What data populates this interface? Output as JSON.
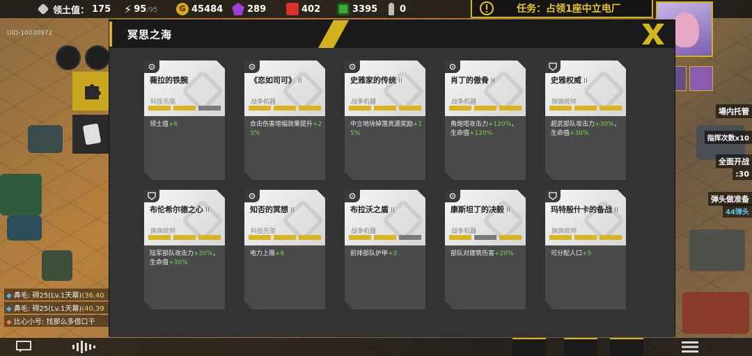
{
  "topbar": {
    "territory_label": "领土值：",
    "territory_value": "175",
    "energy_value": "95",
    "energy_max": "/95",
    "gold_value": "45484",
    "crystal_value": "289",
    "fuel_value": "402",
    "chip_value": "3395",
    "bullet_value": "0"
  },
  "task": {
    "text": "任务：占领1座中立电厂"
  },
  "uid": "UID-10030972",
  "right_panel": {
    "line1": "場内托管",
    "line2": "指挥次数x10",
    "line3": "全面开战",
    "line4": ":30",
    "line5": "弹头做准备",
    "line6": "44弹头"
  },
  "chat": [
    {
      "prefix": "鼻毛: ",
      "text": "碍25(Lv.1天幕)",
      "coord": "(36,40"
    },
    {
      "prefix": "鼻毛: ",
      "text": "碍25(Lv.1天幕)",
      "coord": "(40,39"
    },
    {
      "prefix": "比心小号: ",
      "text": "找那么多借口干",
      "coord": ""
    }
  ],
  "modal": {
    "title": "冥思之海",
    "cards": [
      {
        "name": "薇拉的铁腕",
        "rank": "",
        "category": "科技先驱",
        "bars": [
          1,
          1,
          0
        ],
        "desc": [
          [
            "领土值",
            ""
          ],
          [
            "+6",
            "num"
          ]
        ]
      },
      {
        "name": "《恋如司可》",
        "rank": "II",
        "category": "战争机器",
        "bars": [
          1,
          1,
          1
        ],
        "desc": [
          [
            "合击伤害增幅效果提升",
            ""
          ],
          [
            "+23%",
            "num"
          ]
        ]
      },
      {
        "name": "史雅家的传统",
        "rank": "II",
        "category": "战争机器",
        "bars": [
          1,
          1,
          1
        ],
        "desc": [
          [
            "中立地块掉落资源奖励",
            ""
          ],
          [
            "+15%",
            "num"
          ]
        ]
      },
      {
        "name": "肖丁的傲骨",
        "rank": "II",
        "category": "战争机器",
        "bars": [
          1,
          1,
          1
        ],
        "desc": [
          [
            "角炮塔攻击力",
            ""
          ],
          [
            "+120%",
            "num"
          ],
          [
            "，生命值",
            ""
          ],
          [
            "+120%",
            "num"
          ]
        ]
      },
      {
        "name": "史雅权威",
        "rank": "II",
        "category": "旗旗统帅",
        "bars": [
          1,
          1,
          1
        ],
        "desc": [
          [
            "超武部队攻击力",
            ""
          ],
          [
            "+30%",
            "num"
          ],
          [
            "，生命值",
            ""
          ],
          [
            "+30%",
            "num"
          ]
        ]
      },
      {
        "name": "布伦希尔德之心",
        "rank": "II",
        "category": "旗旗统帅",
        "bars": [
          1,
          1,
          1
        ],
        "desc": [
          [
            "陆军部队攻击力",
            ""
          ],
          [
            "+30%",
            "num"
          ],
          [
            "，生命值",
            ""
          ],
          [
            "+30%",
            "num"
          ]
        ]
      },
      {
        "name": "知否的冥想",
        "rank": "II",
        "category": "科技先驱",
        "bars": [
          1,
          1,
          1
        ],
        "desc": [
          [
            "电力上限",
            ""
          ],
          [
            "+6",
            "num"
          ]
        ]
      },
      {
        "name": "布拉沃之盾",
        "rank": "II",
        "category": "战争机器",
        "bars": [
          1,
          1,
          0
        ],
        "desc": [
          [
            "前排部队护甲",
            ""
          ],
          [
            "+3",
            "num"
          ]
        ]
      },
      {
        "name": "康斯坦丁的决毅",
        "rank": "II",
        "category": "战争机器",
        "bars": [
          1,
          0,
          1
        ],
        "desc": [
          [
            "部队对建筑伤害",
            ""
          ],
          [
            "+20%",
            "num"
          ]
        ]
      },
      {
        "name": "玛特殷什卡的备战",
        "rank": "II",
        "category": "旗旗统帅",
        "bars": [
          1,
          1,
          1
        ],
        "desc": [
          [
            "可分配人口",
            ""
          ],
          [
            "+5",
            "num"
          ]
        ]
      }
    ]
  },
  "colors": {
    "accent": "#d6b51f",
    "bonus": "#6fd84b",
    "panel": "#333333"
  }
}
